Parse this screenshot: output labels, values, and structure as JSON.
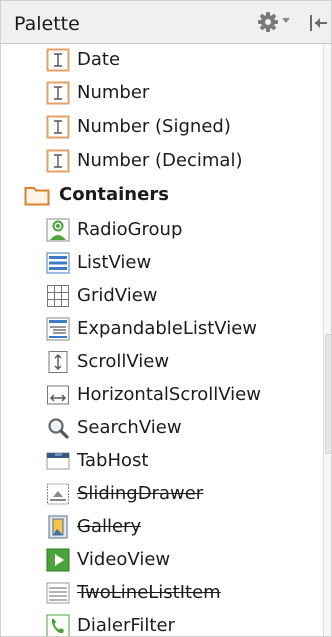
{
  "palette": {
    "title": "Palette",
    "gear_icon": "gear-icon",
    "pin_icon": "pin-icon",
    "items": [
      {
        "label": "Date",
        "icon": "text-field-icon",
        "group": false,
        "deprecated": false
      },
      {
        "label": "Number",
        "icon": "text-field-icon",
        "group": false,
        "deprecated": false
      },
      {
        "label": "Number (Signed)",
        "icon": "text-field-icon",
        "group": false,
        "deprecated": false
      },
      {
        "label": "Number (Decimal)",
        "icon": "text-field-icon",
        "group": false,
        "deprecated": false
      },
      {
        "label": "Containers",
        "icon": "folder-icon",
        "group": true,
        "deprecated": false
      },
      {
        "label": "RadioGroup",
        "icon": "radiogroup-icon",
        "group": false,
        "deprecated": false
      },
      {
        "label": "ListView",
        "icon": "listview-icon",
        "group": false,
        "deprecated": false
      },
      {
        "label": "GridView",
        "icon": "gridview-icon",
        "group": false,
        "deprecated": false
      },
      {
        "label": "ExpandableListView",
        "icon": "expandable-list-icon",
        "group": false,
        "deprecated": false
      },
      {
        "label": "ScrollView",
        "icon": "scrollview-icon",
        "group": false,
        "deprecated": false
      },
      {
        "label": "HorizontalScrollView",
        "icon": "horizontal-scroll-icon",
        "group": false,
        "deprecated": false
      },
      {
        "label": "SearchView",
        "icon": "search-icon",
        "group": false,
        "deprecated": false
      },
      {
        "label": "TabHost",
        "icon": "tabhost-icon",
        "group": false,
        "deprecated": false
      },
      {
        "label": "SlidingDrawer",
        "icon": "sliding-drawer-icon",
        "group": false,
        "deprecated": true
      },
      {
        "label": "Gallery",
        "icon": "gallery-icon",
        "group": false,
        "deprecated": true
      },
      {
        "label": "VideoView",
        "icon": "video-icon",
        "group": false,
        "deprecated": false
      },
      {
        "label": "TwoLineListItem",
        "icon": "two-line-list-icon",
        "group": false,
        "deprecated": true
      },
      {
        "label": "DialerFilter",
        "icon": "phone-icon",
        "group": false,
        "deprecated": false
      }
    ]
  },
  "colors": {
    "text_field_icon": "#e4a06a",
    "folder_icon": "#d9822b",
    "list_icon": "#3e7bc4",
    "green_icon": "#4aa33b"
  }
}
